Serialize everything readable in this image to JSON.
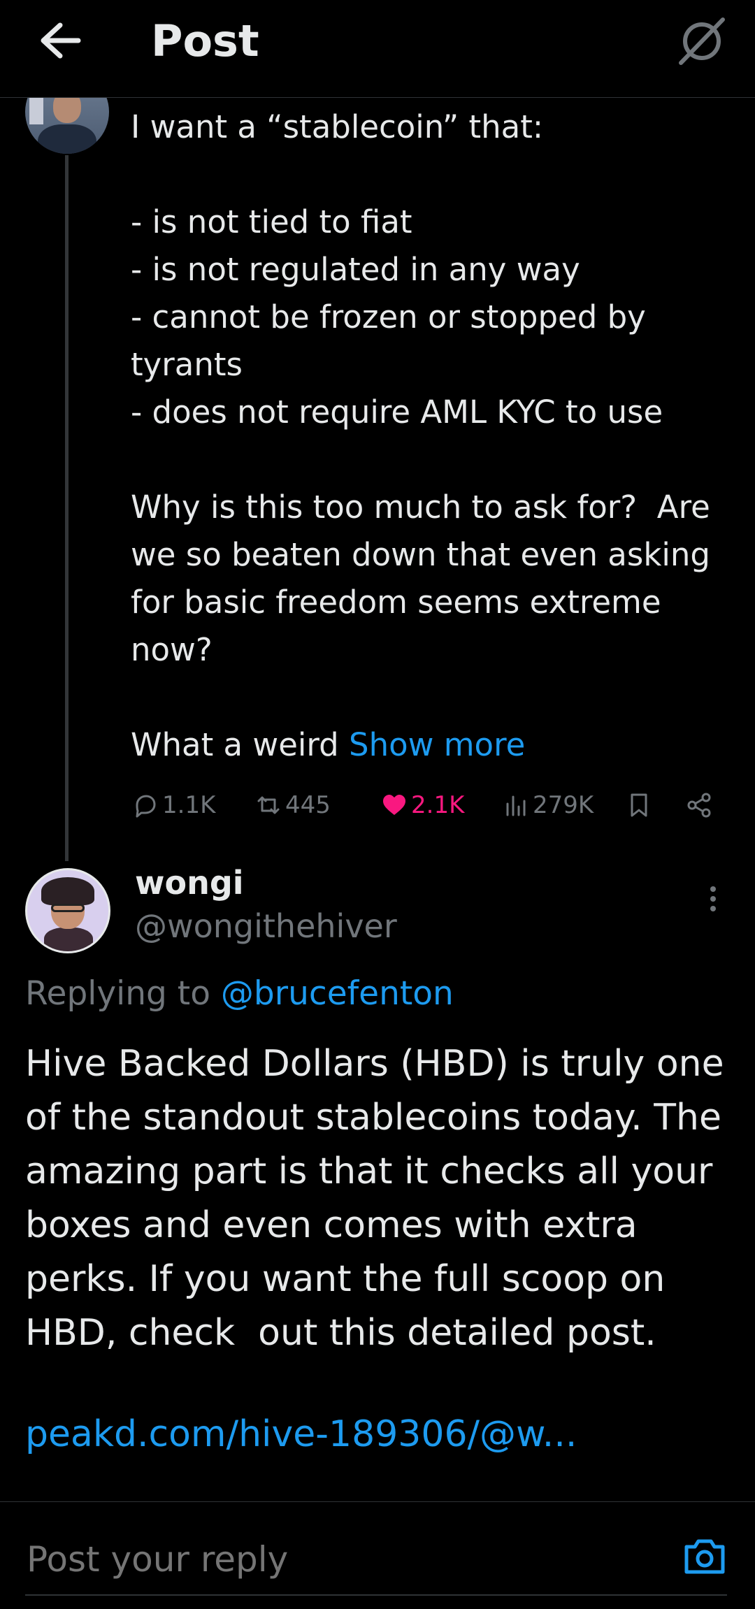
{
  "header": {
    "title": "Post",
    "back_icon": "arrow-left-icon",
    "grok_icon": "grok-icon"
  },
  "original_post": {
    "text": "I want a “stablecoin” that:\n\n- is not tied to fiat\n- is not regulated in any way\n- cannot be frozen or stopped by tyrants\n- does not require AML KYC to use\n\nWhy is this too much to ask for?  Are we so beaten down that even asking for basic freedom seems extreme now?\n\nWhat a weird ",
    "show_more": "Show more",
    "actions": {
      "replies": "1.1K",
      "reposts": "445",
      "likes": "2.1K",
      "views": "279K"
    }
  },
  "reply": {
    "display_name": "wongi",
    "handle": "@wongithehiver",
    "replying_to_label": "Replying to ",
    "replying_to_handle": "@brucefenton",
    "text": "Hive Backed Dollars (HBD) is truly one of the standout stablecoins today. The amazing part is that it checks all your boxes and even comes with extra perks. If you want the full scoop on HBD, check  out this detailed post.",
    "link": "peakd.com/hive-189306/@w..."
  },
  "composer": {
    "placeholder": "Post your reply",
    "camera_icon": "camera-icon"
  },
  "colors": {
    "background": "#000000",
    "text": "#e7e9ea",
    "muted": "#71767b",
    "link": "#1d9bf0",
    "like": "#f91880",
    "divider": "#2f3336"
  }
}
